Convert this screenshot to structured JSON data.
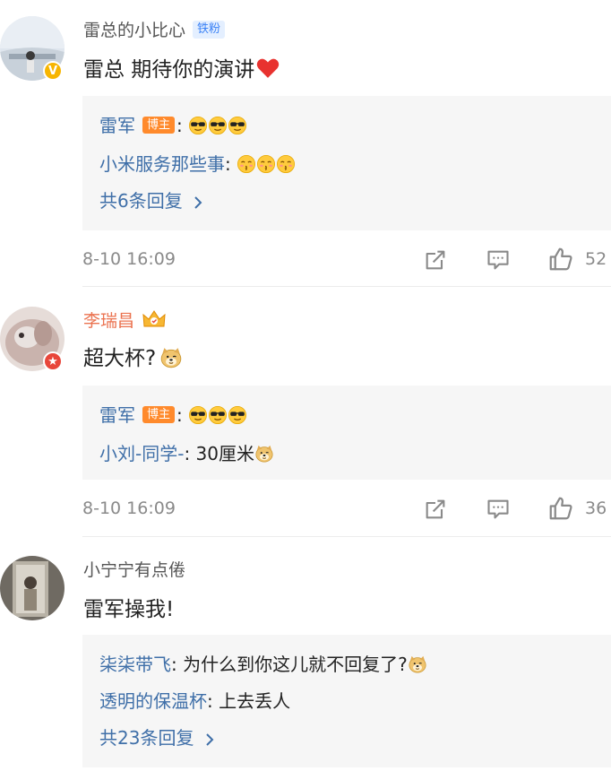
{
  "comments": [
    {
      "user": "雷总的小比心",
      "tag": "铁粉",
      "text": "雷总 期待你的演讲",
      "replies": [
        {
          "name": "雷军",
          "badge": "博主",
          "sep": ":"
        },
        {
          "name": "小米服务那些事",
          "sep": ":"
        }
      ],
      "more": "共6条回复",
      "time": "8-10 16:09",
      "likes": "52"
    },
    {
      "user": "李瑞昌",
      "text": "超大杯?",
      "replies": [
        {
          "name": "雷军",
          "badge": "博主",
          "sep": ":"
        },
        {
          "name": "小刘-同学-",
          "sep": ":",
          "content": "30厘米"
        }
      ],
      "time": "8-10 16:09",
      "likes": "36"
    },
    {
      "user": "小宁宁有点倦",
      "text": "雷军操我!",
      "replies": [
        {
          "name": "柒柒带飞",
          "sep": ":",
          "content": "为什么到你这儿就不回复了?"
        },
        {
          "name": "透明的保温杯",
          "sep": ":",
          "content": "上去丢人"
        }
      ],
      "more": "共23条回复"
    }
  ],
  "icons": {
    "verified_badge": "verified-v-icon",
    "vip_badge": "vip-star-icon",
    "crown": "crown-icon",
    "repost": "repost-icon",
    "comment": "comment-icon",
    "like": "thumbs-up-icon",
    "heart": "red-heart-emoji",
    "sunglasses": "sunglasses-emoji",
    "kiss": "kiss-emoji",
    "doge": "doge-emoji"
  },
  "colors": {
    "link_blue": "#3f6fa8",
    "vip_orange": "#eb7350",
    "blogger_badge": "#ff8a2c",
    "fan_tag_bg": "#e4efff",
    "meta_gray": "#8a8a8a",
    "reply_bg": "#f6f6f6"
  }
}
